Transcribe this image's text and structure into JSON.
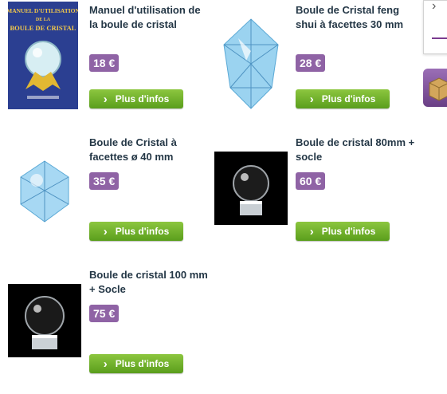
{
  "products": [
    {
      "title": "Manuel d'utilisation de la boule de cristal",
      "price": "18 €",
      "button": "Plus d'infos",
      "image": "book-cover"
    },
    {
      "title": "Boule de Cristal feng shui à facettes 30 mm",
      "price": "28 €",
      "button": "Plus d'infos",
      "image": "faceted-crystal"
    },
    {
      "title": "Boule de Cristal à facettes ø 40 mm",
      "price": "35 €",
      "button": "Plus d'infos",
      "image": "faceted-crystal-small"
    },
    {
      "title": "Boule de cristal 80mm + socle",
      "price": "60 €",
      "button": "Plus d'infos",
      "image": "crystal-ball-stand"
    },
    {
      "title": "Boule de cristal 100 mm + Socle",
      "price": "75 €",
      "button": "Plus d'infos",
      "image": "crystal-ball-stand"
    }
  ],
  "book": {
    "title_line1": "MANUEL D'UTILISATION",
    "title_line2": "DE LA",
    "title_line3": "BOULE DE CRISTAL"
  },
  "colors": {
    "price_badge": "#8f63a5",
    "button": "#6bb02a",
    "title": "#243746"
  }
}
